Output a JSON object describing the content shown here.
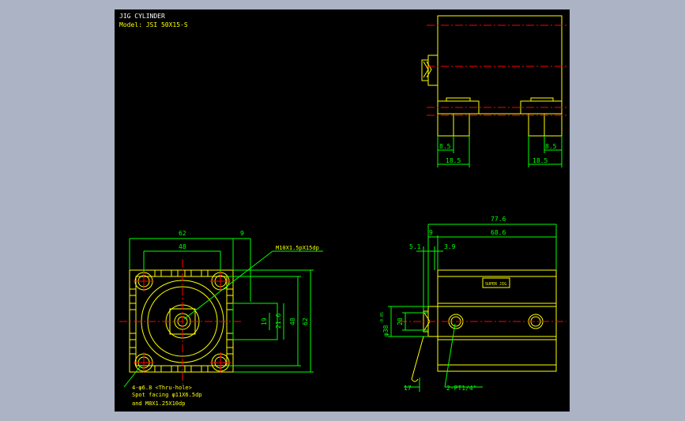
{
  "title": "JIG CYLINDER",
  "model": "Model: JSI 50X15-S",
  "colors": {
    "bg_outer": "#abb3c4",
    "bg_canvas": "#000000",
    "yellow": "#ffff00",
    "green": "#00ff00",
    "red": "#ff0000",
    "white": "#ffffff"
  },
  "front_view": {
    "dim_62_top": "62",
    "dim_9_top": "9",
    "dim_48_top": "48",
    "callout_thread": "M10X1.5pX15dp",
    "dim_19": "19",
    "dim_21_6": "21.6",
    "dim_48_right": "48",
    "dim_62_right": "62",
    "note_line1": "4-φ6.8   <Thru-hole>",
    "note_line2": "Spot facing φ11X6.5dp",
    "note_line3": "and M8X1.25X10dp"
  },
  "side_view": {
    "dim_77_6": "77.6",
    "dim_9": "9",
    "dim_68_6": "68.6",
    "dim_5_1": "5.1",
    "dim_3_9": "3.9",
    "dim_phi38": "φ38",
    "dim_phi38_tol": "-0.05",
    "dim_20": "20",
    "dim_17": "17",
    "port_callout": "2-PT1/4\"",
    "label_plate": "SUPER JIG"
  },
  "top_view": {
    "dim_8_5_left": "8.5",
    "dim_18_5_left": "18.5",
    "dim_8_5_right": "8.5",
    "dim_18_5_right": "18.5"
  }
}
